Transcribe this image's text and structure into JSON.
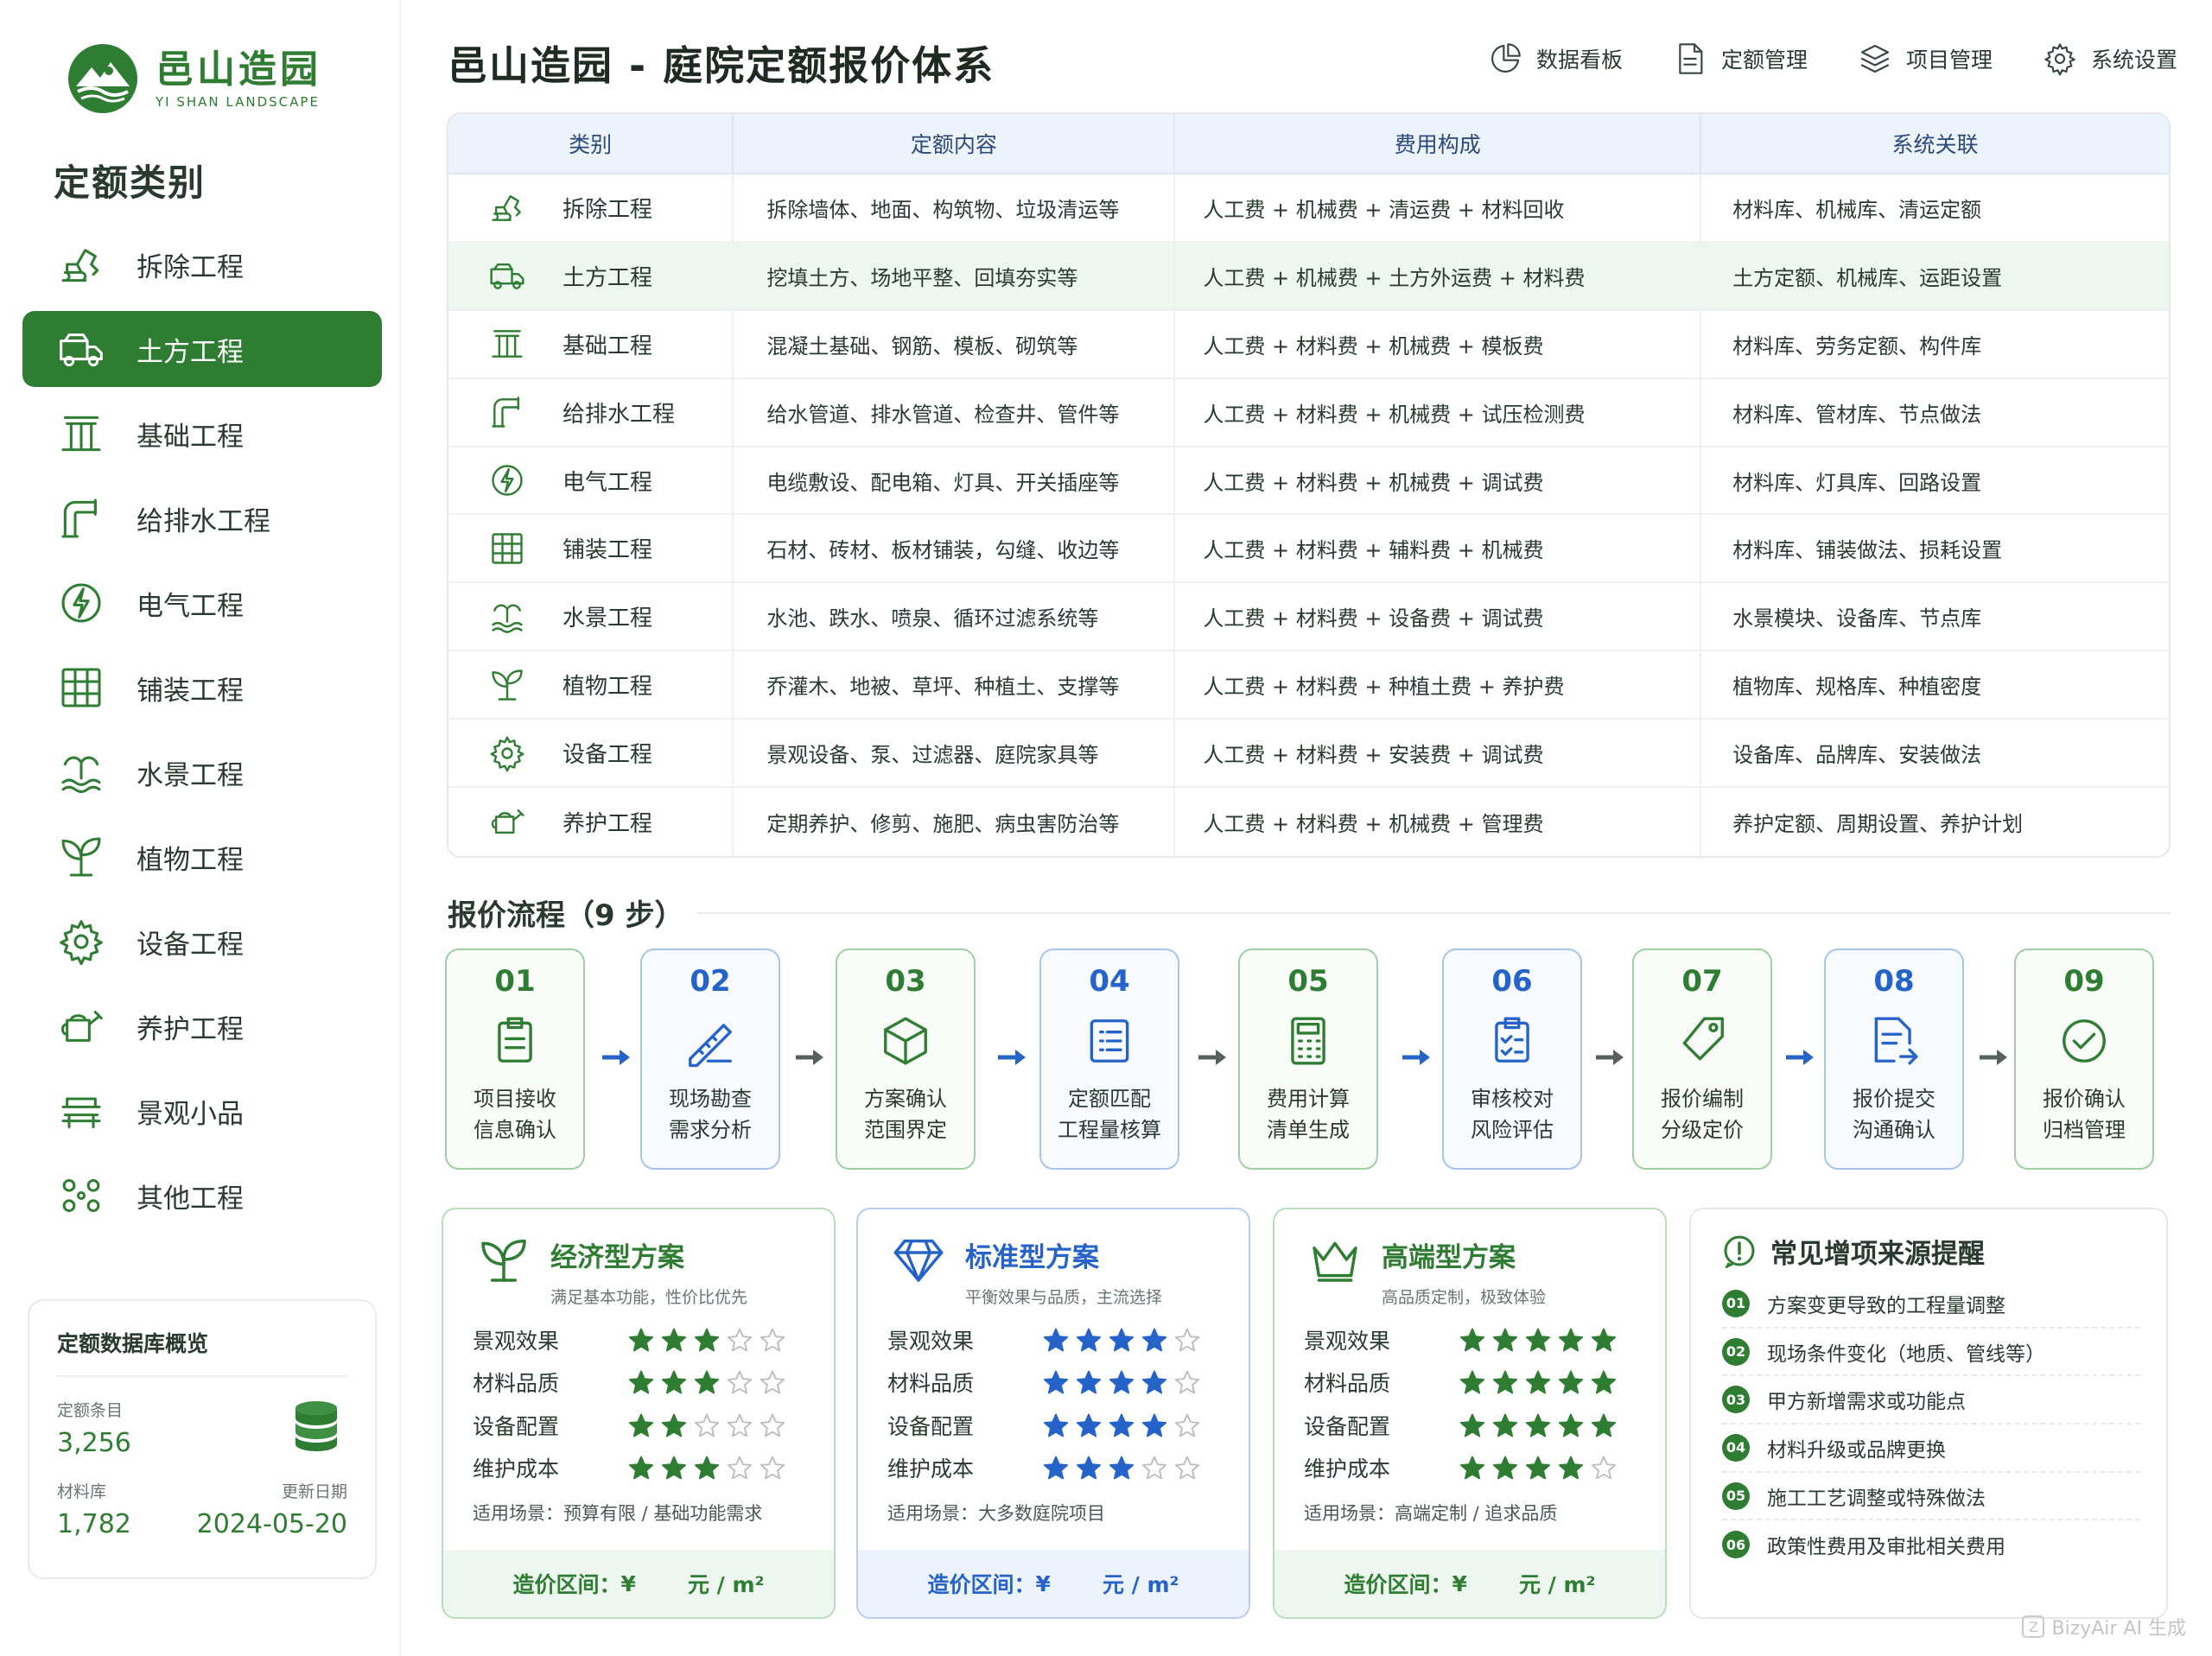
{
  "brand": {
    "name_cn": "邑山造园",
    "name_en": "YI SHAN LANDSCAPE"
  },
  "app_title": "邑山造园 - 庭院定额报价体系",
  "colors": {
    "green": "#2e7d32",
    "blue": "#2563c9",
    "star_gold_green": "#2e7d32"
  },
  "topnav": [
    {
      "label": "数据看板",
      "icon": "pie-chart-icon"
    },
    {
      "label": "定额管理",
      "icon": "document-icon"
    },
    {
      "label": "项目管理",
      "icon": "layers-icon"
    },
    {
      "label": "系统设置",
      "icon": "gear-icon"
    }
  ],
  "sidebar": {
    "title": "定额类别",
    "items": [
      {
        "label": "拆除工程",
        "icon": "excavator-icon"
      },
      {
        "label": "土方工程",
        "icon": "truck-icon",
        "active": true
      },
      {
        "label": "基础工程",
        "icon": "foundation-icon"
      },
      {
        "label": "给排水工程",
        "icon": "pipe-icon"
      },
      {
        "label": "电气工程",
        "icon": "lightning-icon"
      },
      {
        "label": "铺装工程",
        "icon": "grid-icon"
      },
      {
        "label": "水景工程",
        "icon": "fountain-icon"
      },
      {
        "label": "植物工程",
        "icon": "plant-icon"
      },
      {
        "label": "设备工程",
        "icon": "gear-icon"
      },
      {
        "label": "养护工程",
        "icon": "watering-can-icon"
      },
      {
        "label": "景观小品",
        "icon": "bench-icon"
      },
      {
        "label": "其他工程",
        "icon": "dots-icon"
      }
    ],
    "db": {
      "title": "定额数据库概览",
      "entries_label": "定额条目",
      "entries": "3,256",
      "materials_label": "材料库",
      "materials": "1,782",
      "updated_label": "更新日期",
      "updated": "2024-05-20"
    }
  },
  "table": {
    "headers": [
      "类别",
      "定额内容",
      "费用构成",
      "系统关联"
    ],
    "rows": [
      {
        "icon": "excavator-icon",
        "category": "拆除工程",
        "content": "拆除墙体、地面、构筑物、垃圾清运等",
        "cost": "人工费 + 机械费 + 清运费 + 材料回收",
        "link": "材料库、机械库、清运定额"
      },
      {
        "icon": "truck-icon",
        "category": "土方工程",
        "content": "挖填土方、场地平整、回填夯实等",
        "cost": "人工费 + 机械费 + 土方外运费 + 材料费",
        "link": "土方定额、机械库、运距设置",
        "highlight": true
      },
      {
        "icon": "foundation-icon",
        "category": "基础工程",
        "content": "混凝土基础、钢筋、模板、砌筑等",
        "cost": "人工费 + 材料费 + 机械费 + 模板费",
        "link": "材料库、劳务定额、构件库"
      },
      {
        "icon": "pipe-icon",
        "category": "给排水工程",
        "content": "给水管道、排水管道、检查井、管件等",
        "cost": "人工费 + 材料费 + 机械费 + 试压检测费",
        "link": "材料库、管材库、节点做法"
      },
      {
        "icon": "lightning-icon",
        "category": "电气工程",
        "content": "电缆敷设、配电箱、灯具、开关插座等",
        "cost": "人工费 + 材料费 + 机械费 + 调试费",
        "link": "材料库、灯具库、回路设置"
      },
      {
        "icon": "grid-icon",
        "category": "铺装工程",
        "content": "石材、砖材、板材铺装，勾缝、收边等",
        "cost": "人工费 + 材料费 + 辅料费 + 机械费",
        "link": "材料库、铺装做法、损耗设置"
      },
      {
        "icon": "fountain-icon",
        "category": "水景工程",
        "content": "水池、跌水、喷泉、循环过滤系统等",
        "cost": "人工费 + 材料费 + 设备费 + 调试费",
        "link": "水景模块、设备库、节点库"
      },
      {
        "icon": "plant-icon",
        "category": "植物工程",
        "content": "乔灌木、地被、草坪、种植土、支撑等",
        "cost": "人工费 + 材料费 + 种植土费 + 养护费",
        "link": "植物库、规格库、种植密度"
      },
      {
        "icon": "gear-icon",
        "category": "设备工程",
        "content": "景观设备、泵、过滤器、庭院家具等",
        "cost": "人工费 + 材料费 + 安装费 + 调试费",
        "link": "设备库、品牌库、安装做法"
      },
      {
        "icon": "watering-can-icon",
        "category": "养护工程",
        "content": "定期养护、修剪、施肥、病虫害防治等",
        "cost": "人工费 + 材料费 + 机械费 + 管理费",
        "link": "养护定额、周期设置、养护计划"
      }
    ]
  },
  "process": {
    "title": "报价流程（9 步）",
    "steps": [
      {
        "num": "01",
        "l1": "项目接收",
        "l2": "信息确认",
        "icon": "clipboard-icon",
        "tone": "g"
      },
      {
        "num": "02",
        "l1": "现场勘查",
        "l2": "需求分析",
        "icon": "ruler-icon",
        "tone": "b"
      },
      {
        "num": "03",
        "l1": "方案确认",
        "l2": "范围界定",
        "icon": "cube-icon",
        "tone": "g"
      },
      {
        "num": "04",
        "l1": "定额匹配",
        "l2": "工程量核算",
        "icon": "list-icon",
        "tone": "b"
      },
      {
        "num": "05",
        "l1": "费用计算",
        "l2": "清单生成",
        "icon": "calculator-icon",
        "tone": "g"
      },
      {
        "num": "06",
        "l1": "审核校对",
        "l2": "风险评估",
        "icon": "checklist-icon",
        "tone": "b"
      },
      {
        "num": "07",
        "l1": "报价编制",
        "l2": "分级定价",
        "icon": "tag-icon",
        "tone": "g"
      },
      {
        "num": "08",
        "l1": "报价提交",
        "l2": "沟通确认",
        "icon": "send-doc-icon",
        "tone": "b"
      },
      {
        "num": "09",
        "l1": "报价确认",
        "l2": "归档管理",
        "icon": "check-circle-icon",
        "tone": "g"
      }
    ]
  },
  "plans": [
    {
      "name": "经济型方案",
      "sub": "满足基本功能，性价比优先",
      "icon": "leaf-icon",
      "tone": "g",
      "ratings": [
        {
          "label": "景观效果",
          "stars": 3
        },
        {
          "label": "材料品质",
          "stars": 3
        },
        {
          "label": "设备配置",
          "stars": 2
        },
        {
          "label": "维护成本",
          "stars": 3
        }
      ],
      "scene": "适用场景：预算有限 / 基础功能需求",
      "price_label": "造价区间：",
      "currency": "¥",
      "unit": "元 / m²"
    },
    {
      "name": "标准型方案",
      "sub": "平衡效果与品质，主流选择",
      "icon": "diamond-icon",
      "tone": "b",
      "ratings": [
        {
          "label": "景观效果",
          "stars": 4
        },
        {
          "label": "材料品质",
          "stars": 4
        },
        {
          "label": "设备配置",
          "stars": 4
        },
        {
          "label": "维护成本",
          "stars": 3
        }
      ],
      "scene": "适用场景：大多数庭院项目",
      "price_label": "造价区间：",
      "currency": "¥",
      "unit": "元 / m²"
    },
    {
      "name": "高端型方案",
      "sub": "高品质定制，极致体验",
      "icon": "crown-icon",
      "tone": "g",
      "ratings": [
        {
          "label": "景观效果",
          "stars": 5
        },
        {
          "label": "材料品质",
          "stars": 5
        },
        {
          "label": "设备配置",
          "stars": 5
        },
        {
          "label": "维护成本",
          "stars": 4
        }
      ],
      "scene": "适用场景：高端定制 / 追求品质",
      "price_label": "造价区间：",
      "currency": "¥",
      "unit": "元 / m²"
    }
  ],
  "reminders": {
    "title": "常见增项来源提醒",
    "items": [
      {
        "num": "01",
        "text": "方案变更导致的工程量调整"
      },
      {
        "num": "02",
        "text": "现场条件变化（地质、管线等）"
      },
      {
        "num": "03",
        "text": "甲方新增需求或功能点"
      },
      {
        "num": "04",
        "text": "材料升级或品牌更换"
      },
      {
        "num": "05",
        "text": "施工工艺调整或特殊做法"
      },
      {
        "num": "06",
        "text": "政策性费用及审批相关费用"
      }
    ]
  },
  "watermark": "BizyAir AI 生成"
}
